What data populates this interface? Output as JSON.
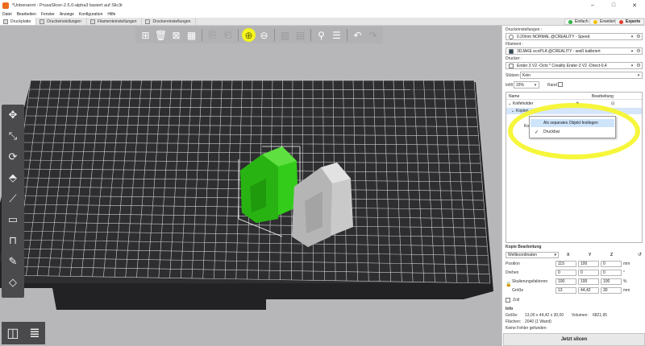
{
  "window": {
    "title": "*Unbenannt - PrusaSlicer-2.5.0-alpha3 basiert auf Slic3r",
    "controls": [
      "–",
      "□",
      "✕"
    ]
  },
  "menu": [
    "Datei",
    "Bearbeiten",
    "Fenster",
    "Anzeige",
    "Konfiguration",
    "Hilfe"
  ],
  "tabs": [
    {
      "label": "Druckplatte",
      "active": true
    },
    {
      "label": "Druckeinstellungen",
      "active": false
    },
    {
      "label": "Filamenteinstellungen",
      "active": false
    },
    {
      "label": "Druckereinstellungen",
      "active": false
    }
  ],
  "modes": {
    "simple": {
      "label": "Einfach",
      "color": "#2fb544"
    },
    "advanced": {
      "label": "Erweitert",
      "color": "#f5c400"
    },
    "expert": {
      "label": "Experte",
      "color": "#e53d2f"
    }
  },
  "top_toolbar": [
    {
      "icon": "add-icon",
      "dim": false
    },
    {
      "icon": "delete-icon",
      "dim": false
    },
    {
      "icon": "delete-all-icon",
      "dim": false
    },
    {
      "icon": "arrange-icon",
      "dim": false
    },
    {
      "icon": "copy-icon",
      "dim": true
    },
    {
      "icon": "paste-icon",
      "dim": true
    },
    {
      "icon": "add-instance-icon",
      "dim": false,
      "highlight": true
    },
    {
      "icon": "remove-instance-icon",
      "dim": false
    },
    {
      "icon": "split-objects-icon",
      "dim": true
    },
    {
      "icon": "split-parts-icon",
      "dim": true
    },
    {
      "icon": "search-icon",
      "dim": false
    },
    {
      "icon": "layer-editing-icon",
      "dim": false
    },
    {
      "icon": "undo-icon",
      "dim": false
    },
    {
      "icon": "redo-icon",
      "dim": true
    }
  ],
  "left_tools": [
    "move-icon",
    "scale-icon",
    "rotate-icon",
    "place-on-face-icon",
    "cut-icon",
    "hollow-icon",
    "sla-support-icon",
    "seam-painting-icon",
    "measure-cube-icon"
  ],
  "view_buttons": [
    "3d-view-icon",
    "preview-layers-icon"
  ],
  "panel": {
    "print_settings_label": "Druckeinstellungen :",
    "print_profile": "0.20mm NORMAL @CREALITY - Speed",
    "filament_label": "Filament :",
    "filament_profile": "3DJAKE ecoPLA @CREALITY - weiß kalibriert",
    "printer_label": "Drucker :",
    "printer_profile": "Ender 3 V2 -Octo * Creality Ender-3 V2 -Direct-0,4",
    "supports_label": "Stützen",
    "supports_value": "Kein",
    "infill_label": "Infill",
    "infill_value": "15%",
    "brim_label": "Rand"
  },
  "object_list": {
    "col_name": "Name",
    "col_edit": "Bearbeitung",
    "rows": [
      {
        "label": "Knifeholder",
        "indent": 0,
        "expander": "⌄"
      },
      {
        "label": "Kopien",
        "indent": 1,
        "expander": "⌄",
        "selected": true
      },
      {
        "label": "Kopie 2",
        "indent": 2,
        "expander": ""
      }
    ]
  },
  "context_menu": {
    "items": [
      {
        "label": "Als separates Objekt festlegen",
        "hover": true,
        "checked": false
      },
      {
        "label": "Druckbar",
        "hover": false,
        "checked": true
      }
    ]
  },
  "manipulation": {
    "title": "Kopie Bearbeitung",
    "coord_system": "Weltkoordinaten",
    "axes": [
      "X",
      "Y",
      "Z"
    ],
    "position_label": "Position",
    "position": [
      "115",
      "100",
      "0"
    ],
    "position_unit": "mm",
    "rotation_label": "Drehen",
    "rotation": [
      "0",
      "0",
      "0"
    ],
    "rotation_unit": "°",
    "scale_label": "Skalierungsfaktoren",
    "scale": [
      "100",
      "100",
      "100"
    ],
    "scale_unit": "%",
    "size_label": "Größe",
    "size": [
      "13",
      "44,42",
      "30"
    ],
    "size_unit": "mm",
    "inch_label": "Zoll"
  },
  "info": {
    "title": "Info",
    "size_label": "Größe:",
    "size_value": "13,00 x 44,42 x 30,00",
    "volume_label": "Volumen:",
    "volume_value": "6821,95",
    "faces_label": "Flächen:",
    "faces_value": "2040 (1 Wand)",
    "errors": "Keine Fehler gefunden"
  },
  "slice_button": "Jetzt slicen",
  "colors": {
    "bed": "#2e2e30",
    "grid": "#cfcfd2",
    "selected_object": "#33cc1a",
    "other_object": "#c9c9c9",
    "highlight": "#f5f530"
  }
}
